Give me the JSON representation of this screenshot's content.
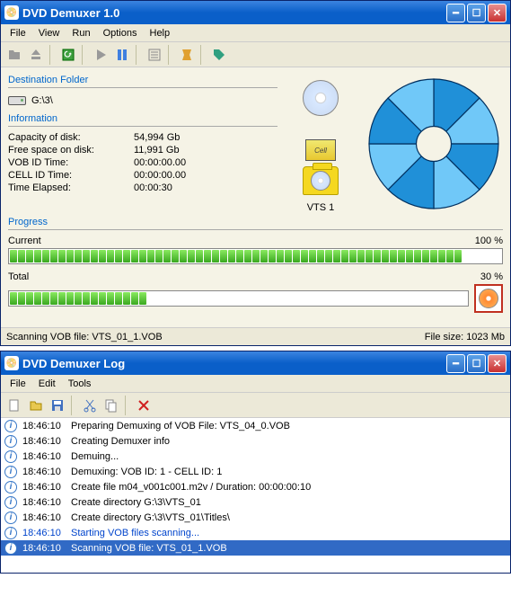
{
  "main": {
    "title": "DVD Demuxer 1.0",
    "menu": [
      "File",
      "View",
      "Run",
      "Options",
      "Help"
    ],
    "destination": {
      "title": "Destination Folder",
      "path": "G:\\3\\"
    },
    "information": {
      "title": "Information",
      "rows": [
        {
          "label": "Capacity of disk:",
          "value": "54,994 Gb"
        },
        {
          "label": "Free space on disk:",
          "value": "11,991 Gb"
        },
        {
          "label": "VOB ID Time:",
          "value": "00:00:00.00"
        },
        {
          "label": "CELL ID Time:",
          "value": "00:00:00.00"
        },
        {
          "label": "Time Elapsed:",
          "value": "00:00:30"
        }
      ]
    },
    "center": {
      "vob_label": "Cell",
      "vts_label": "VTS 1"
    },
    "progress": {
      "title": "Progress",
      "current_label": "Current",
      "current_pct": "100 %",
      "current_segs": 56,
      "total_label": "Total",
      "total_pct": "30 %",
      "total_segs_filled": 17,
      "total_segs_cap": 56
    },
    "status": {
      "left": "Scanning VOB file: VTS_01_1.VOB",
      "right": "File size: 1023 Mb"
    }
  },
  "log": {
    "title": "DVD Demuxer Log",
    "menu": [
      "File",
      "Edit",
      "Tools"
    ],
    "rows": [
      {
        "time": "18:46:10",
        "text": "Preparing Demuxing of VOB File: VTS_04_0.VOB"
      },
      {
        "time": "18:46:10",
        "text": "Creating Demuxer info"
      },
      {
        "time": "18:46:10",
        "text": "Demuing..."
      },
      {
        "time": "18:46:10",
        "text": "Demuxing: VOB ID: 1 - CELL ID: 1"
      },
      {
        "time": "18:46:10",
        "text": "Create file m04_v001c001.m2v / Duration: 00:00:00:10"
      },
      {
        "time": "18:46:10",
        "text": "Create directory G:\\3\\VTS_01"
      },
      {
        "time": "18:46:10",
        "text": "Create directory G:\\3\\VTS_01\\Titles\\"
      },
      {
        "time": "18:46:10",
        "text": "Starting VOB files scanning...",
        "link": true
      },
      {
        "time": "18:46:10",
        "text": "Scanning VOB file: VTS_01_1.VOB",
        "sel": true
      }
    ]
  },
  "chart_data": {
    "type": "pie",
    "title": "",
    "slices": 8,
    "colors": [
      "#2090d8",
      "#70c8f8",
      "#2090d8",
      "#70c8f8",
      "#2090d8",
      "#70c8f8",
      "#2090d8",
      "#70c8f8"
    ],
    "values": [
      12.5,
      12.5,
      12.5,
      12.5,
      12.5,
      12.5,
      12.5,
      12.5
    ]
  }
}
